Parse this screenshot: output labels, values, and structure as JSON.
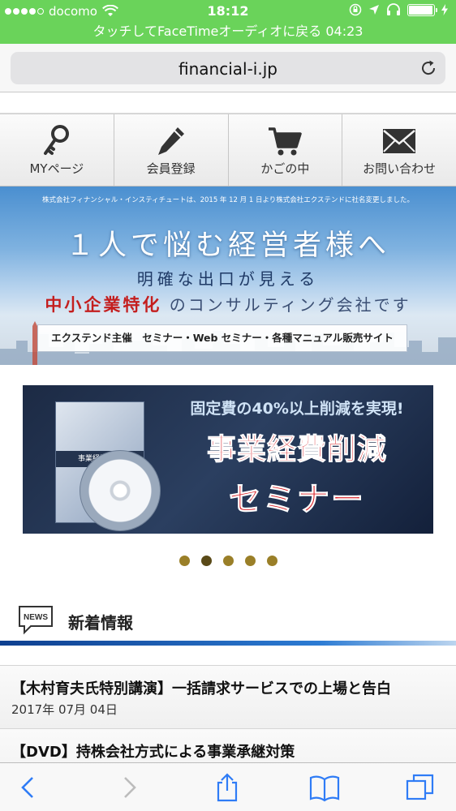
{
  "status_bar": {
    "carrier": "docomo",
    "time": "18:12",
    "signal_bars_filled": 4,
    "signal_bars_total": 5,
    "battery_level": 0.95
  },
  "facetime_banner": {
    "text": "タッチしてFaceTimeオーディオに戻る 04:23"
  },
  "browser": {
    "url": "financial-i.jp"
  },
  "site_nav": [
    {
      "label": "MYページ",
      "icon": "key-icon"
    },
    {
      "label": "会員登録",
      "icon": "pencil-icon"
    },
    {
      "label": "かごの中",
      "icon": "cart-icon"
    },
    {
      "label": "お問い合わせ",
      "icon": "envelope-icon"
    }
  ],
  "hero": {
    "notice": "株式会社フィナンシャル・インスティチュートは、2015 年 12 月 1 日より株式会社エクステンドに社名変更しました。",
    "headline": "１人で悩む経営者様へ",
    "subhead": "明確な出口が見える",
    "tagline_red": "中小企業特化",
    "tagline_rest": "のコンサルティング会社です",
    "pill": "エクステンド主催　セミナー・Web セミナー・各種マニュアル販売サイト"
  },
  "banner": {
    "tagline": "固定費の40%以上削減を実現!",
    "title_line1": "事業経費削減",
    "title_line2": "セミナー",
    "dvd_caption": "事業経費削減"
  },
  "carousel": {
    "count": 5,
    "active_index": 1
  },
  "news": {
    "heading": "新着情報",
    "icon_label": "NEWS",
    "items": [
      {
        "title": "【木村育夫氏特別講演】一括請求サービスでの上場と告白",
        "date": "2017年 07月 04日"
      },
      {
        "title": "【DVD】持株会社方式による事業承継対策",
        "date": ""
      }
    ]
  },
  "colors": {
    "status_green": "#6ad35a",
    "ios_blue": "#2f7cf6",
    "banner_red": "#d81e25",
    "dot_gold": "#9a7f28"
  }
}
